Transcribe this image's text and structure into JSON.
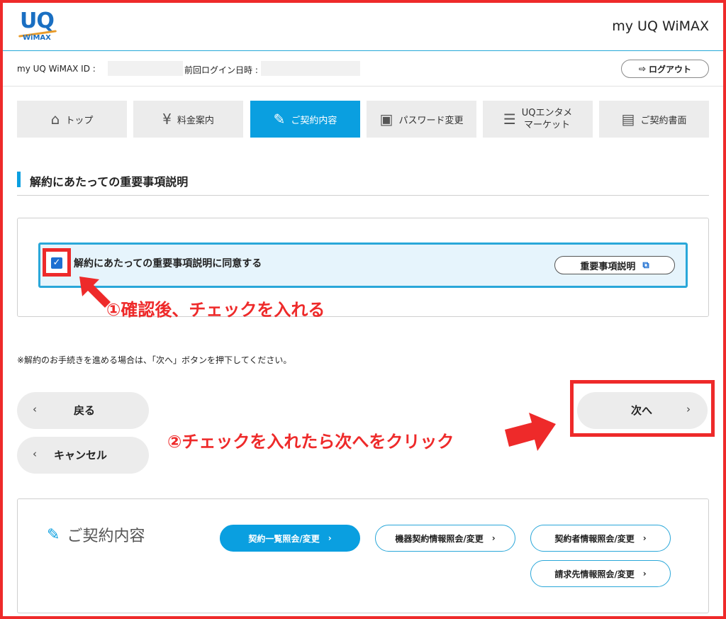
{
  "header": {
    "logo_text": "UQ",
    "logo_sub": "WiMAX",
    "brand": "my UQ WiMAX"
  },
  "infobar": {
    "id_label": "my UQ WiMAX ID :",
    "last_login_label": "前回ログイン日時 :",
    "logout_label": "ログアウト"
  },
  "nav": {
    "items": [
      {
        "label": "トップ",
        "icon": "home-icon"
      },
      {
        "label": "料金案内",
        "icon": "yen-icon"
      },
      {
        "label": "ご契約内容",
        "icon": "edit-icon",
        "active": true
      },
      {
        "label": "パスワード変更",
        "icon": "lock-icon"
      },
      {
        "label_line1": "UQエンタメ",
        "label_line2": "マーケット",
        "icon": "list-gear-icon"
      },
      {
        "label": "ご契約書面",
        "icon": "document-icon"
      }
    ]
  },
  "section": {
    "title": "解約にあたっての重要事項説明"
  },
  "agreement": {
    "checkbox_checked": true,
    "label": "解約にあたっての重要事項説明に同意する",
    "doc_button": "重要事項説明"
  },
  "annotations": {
    "step1": "①確認後、チェックを入れる",
    "step2": "②チェックを入れたら次へをクリック"
  },
  "note": "※解約のお手続きを進める場合は、「次へ」ボタンを押下してください。",
  "buttons": {
    "back": "戻る",
    "cancel": "キャンセル",
    "next": "次へ"
  },
  "contract_panel": {
    "title": "ご契約内容",
    "links": [
      {
        "label": "契約一覧照会/変更",
        "primary": true
      },
      {
        "label": "機器契約情報照会/変更"
      },
      {
        "label": "契約者情報照会/変更"
      },
      {
        "label": "請求先情報照会/変更"
      }
    ]
  },
  "colors": {
    "accent": "#0a9fe0",
    "annotation": "#ee2a2a",
    "checkbox": "#1d6fd1"
  }
}
